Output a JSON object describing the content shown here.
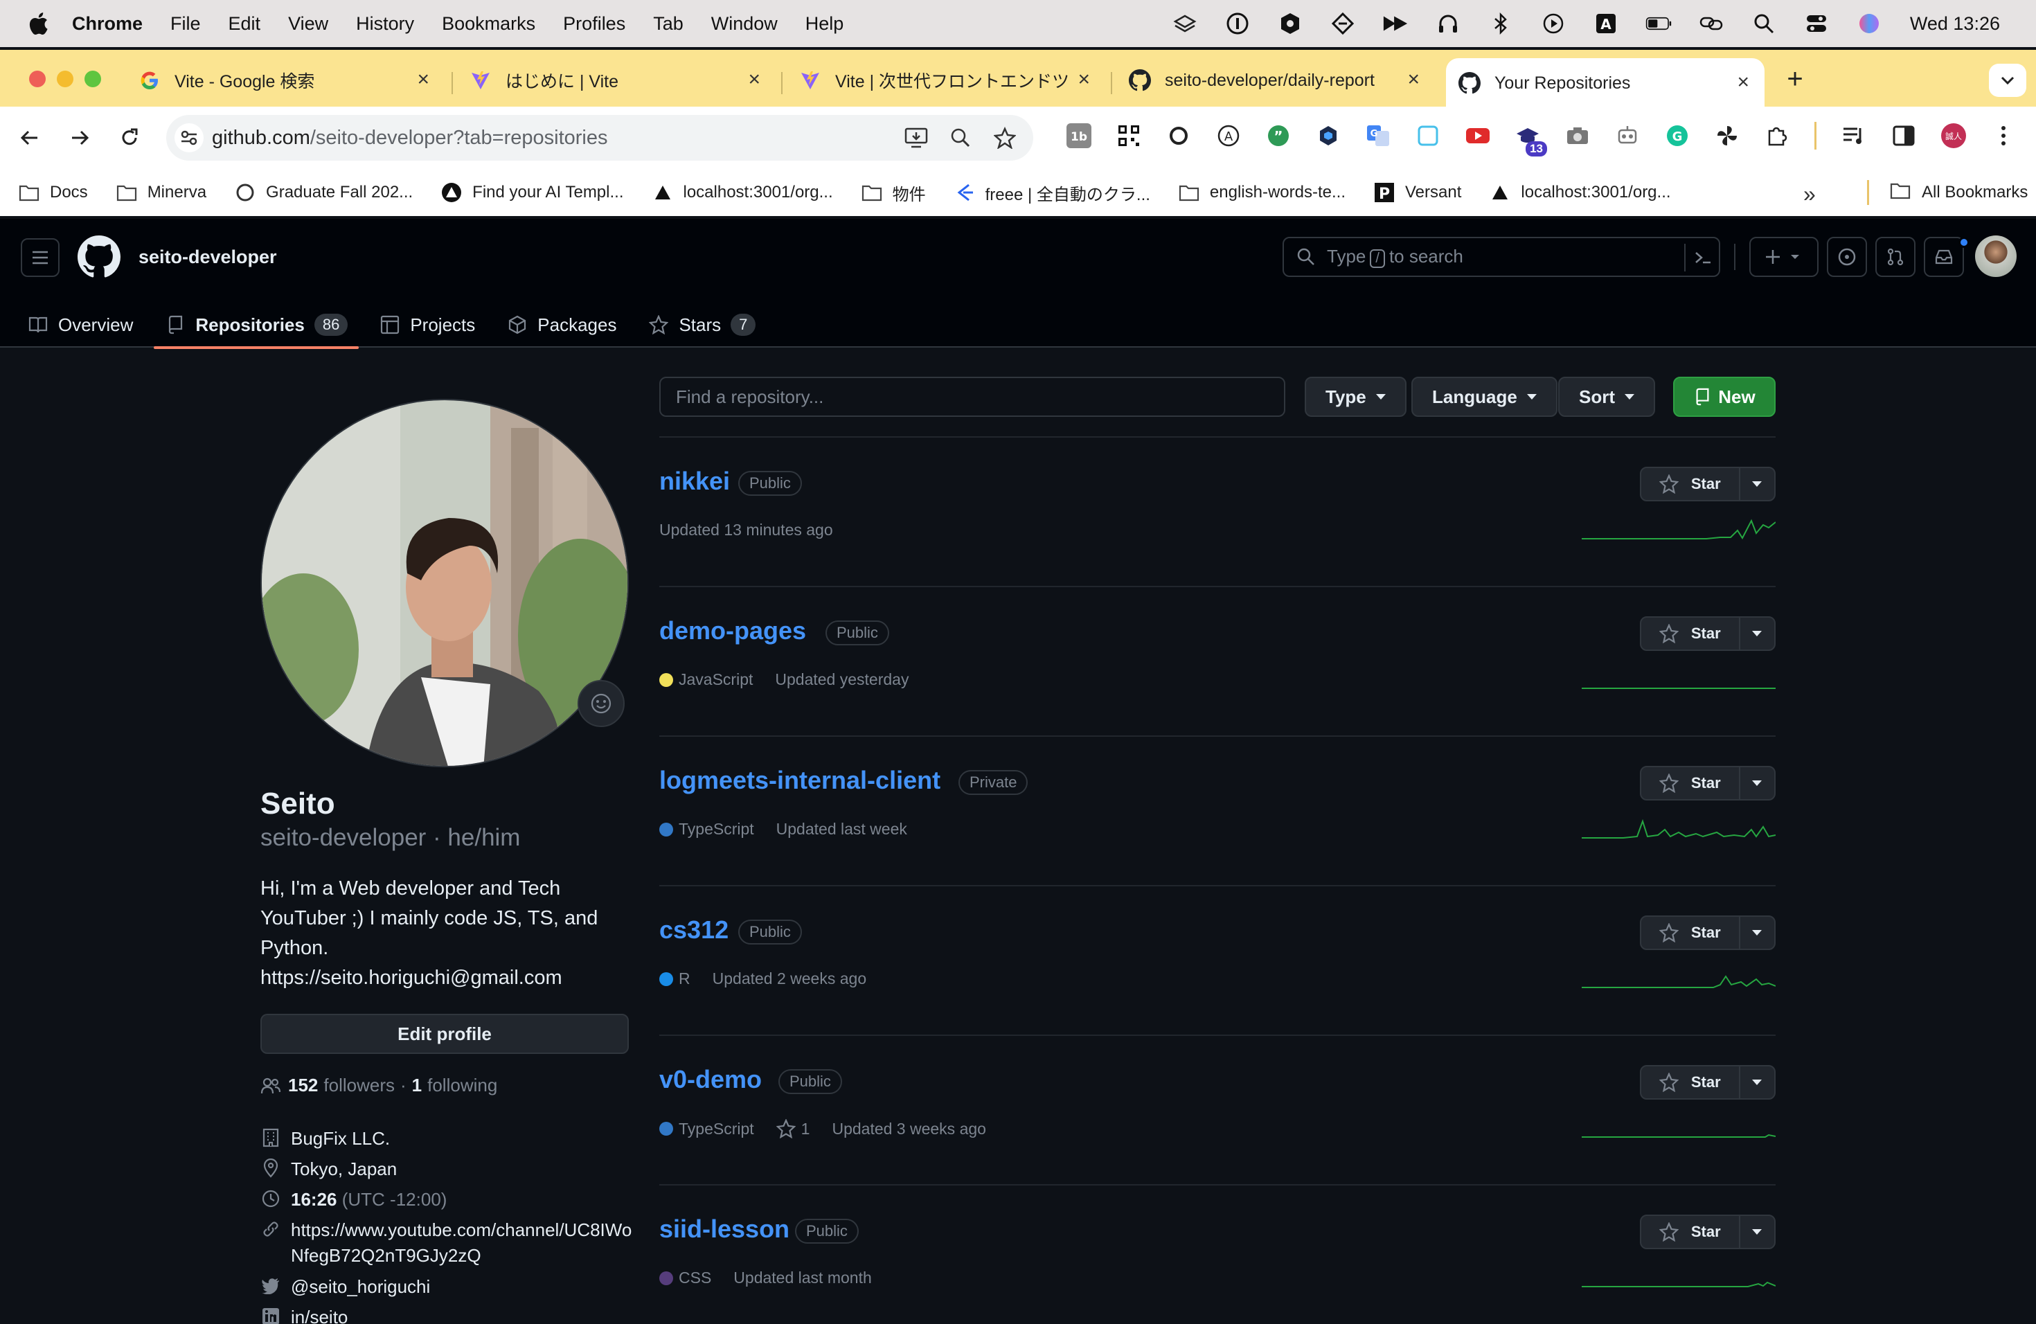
{
  "menubar": {
    "app": "Chrome",
    "items": [
      "File",
      "Edit",
      "View",
      "History",
      "Bookmarks",
      "Profiles",
      "Tab",
      "Window",
      "Help"
    ],
    "clock": "Wed  13:26"
  },
  "tabs": [
    {
      "title": "Vite - Google 検索",
      "icon": "google-icon"
    },
    {
      "title": "はじめに | Vite",
      "icon": "vite-icon"
    },
    {
      "title": "Vite | 次世代フロントエンドツ…",
      "icon": "vite-icon"
    },
    {
      "title": "seito-developer/daily-report",
      "icon": "github-icon"
    },
    {
      "title": "Your Repositories",
      "icon": "github-icon",
      "active": true
    }
  ],
  "omnibox": {
    "host": "github.com",
    "path": "/seito-developer?tab=repositories"
  },
  "extensions": {
    "badge": "13",
    "profile_initials": "誠人"
  },
  "bookmarks": [
    {
      "label": "Docs",
      "icon": "folder-icon"
    },
    {
      "label": "Minerva",
      "icon": "folder-icon"
    },
    {
      "label": "Graduate Fall 202...",
      "icon": "circle-icon"
    },
    {
      "label": "Find your AI Templ...",
      "icon": "triangle-badge-icon"
    },
    {
      "label": "localhost:3001/org...",
      "icon": "triangle-icon"
    },
    {
      "label": "物件",
      "icon": "folder-icon"
    },
    {
      "label": "freee | 全自動のクラ...",
      "icon": "freee-icon"
    },
    {
      "label": "english-words-te...",
      "icon": "folder-icon"
    },
    {
      "label": "Versant",
      "icon": "p-icon"
    },
    {
      "label": "localhost:3001/org...",
      "icon": "triangle-icon"
    }
  ],
  "bookmarks_more": "»",
  "bookmarks_all": "All Bookmarks",
  "github": {
    "username": "seito-developer",
    "search_placeholder_pre": "Type",
    "search_slash": "/",
    "search_placeholder_post": "to search",
    "tabs": [
      {
        "label": "Overview"
      },
      {
        "label": "Repositories",
        "count": "86"
      },
      {
        "label": "Projects"
      },
      {
        "label": "Packages"
      },
      {
        "label": "Stars",
        "count": "7"
      }
    ],
    "profile": {
      "name": "Seito",
      "handle": "seito-developer · he/him",
      "bio": "Hi, I'm a Web developer and Tech YouTuber ;) I mainly code JS, TS, and Python. https://seito.horiguchi@gmail.com",
      "edit_label": "Edit profile",
      "followers_count": "152",
      "followers_label": "followers",
      "following_sep": "·",
      "following_count": "1",
      "following_label": "following",
      "company": "BugFix LLC.",
      "location": "Tokyo, Japan",
      "time": "16:26",
      "timezone": "(UTC -12:00)",
      "website": "https://www.youtube.com/channel/UC8IWoNfegB72Q2nT9GJy2zQ",
      "twitter": "@seito_horiguchi",
      "linkedin": "in/seito"
    },
    "filters": {
      "find_placeholder": "Find a repository...",
      "type": "Type",
      "language": "Language",
      "sort": "Sort",
      "new": "New"
    },
    "star_label": "Star",
    "repos": [
      {
        "name": "nikkei",
        "visibility": "Public",
        "language": "",
        "lang_color": "",
        "stars": "",
        "updated": "Updated 13 minutes ago"
      },
      {
        "name": "demo-pages",
        "visibility": "Public",
        "language": "JavaScript",
        "lang_color": "#f1e05a",
        "stars": "",
        "updated": "Updated yesterday"
      },
      {
        "name": "logmeets-internal-client",
        "visibility": "Private",
        "language": "TypeScript",
        "lang_color": "#3178c6",
        "stars": "",
        "updated": "Updated last week"
      },
      {
        "name": "cs312",
        "visibility": "Public",
        "language": "R",
        "lang_color": "#198ce7",
        "stars": "",
        "updated": "Updated 2 weeks ago"
      },
      {
        "name": "v0-demo",
        "visibility": "Public",
        "language": "TypeScript",
        "lang_color": "#3178c6",
        "stars": "1",
        "updated": "Updated 3 weeks ago"
      },
      {
        "name": "siid-lesson",
        "visibility": "Public",
        "language": "CSS",
        "lang_color": "#563d7c",
        "stars": "",
        "updated": "Updated last month"
      }
    ]
  }
}
